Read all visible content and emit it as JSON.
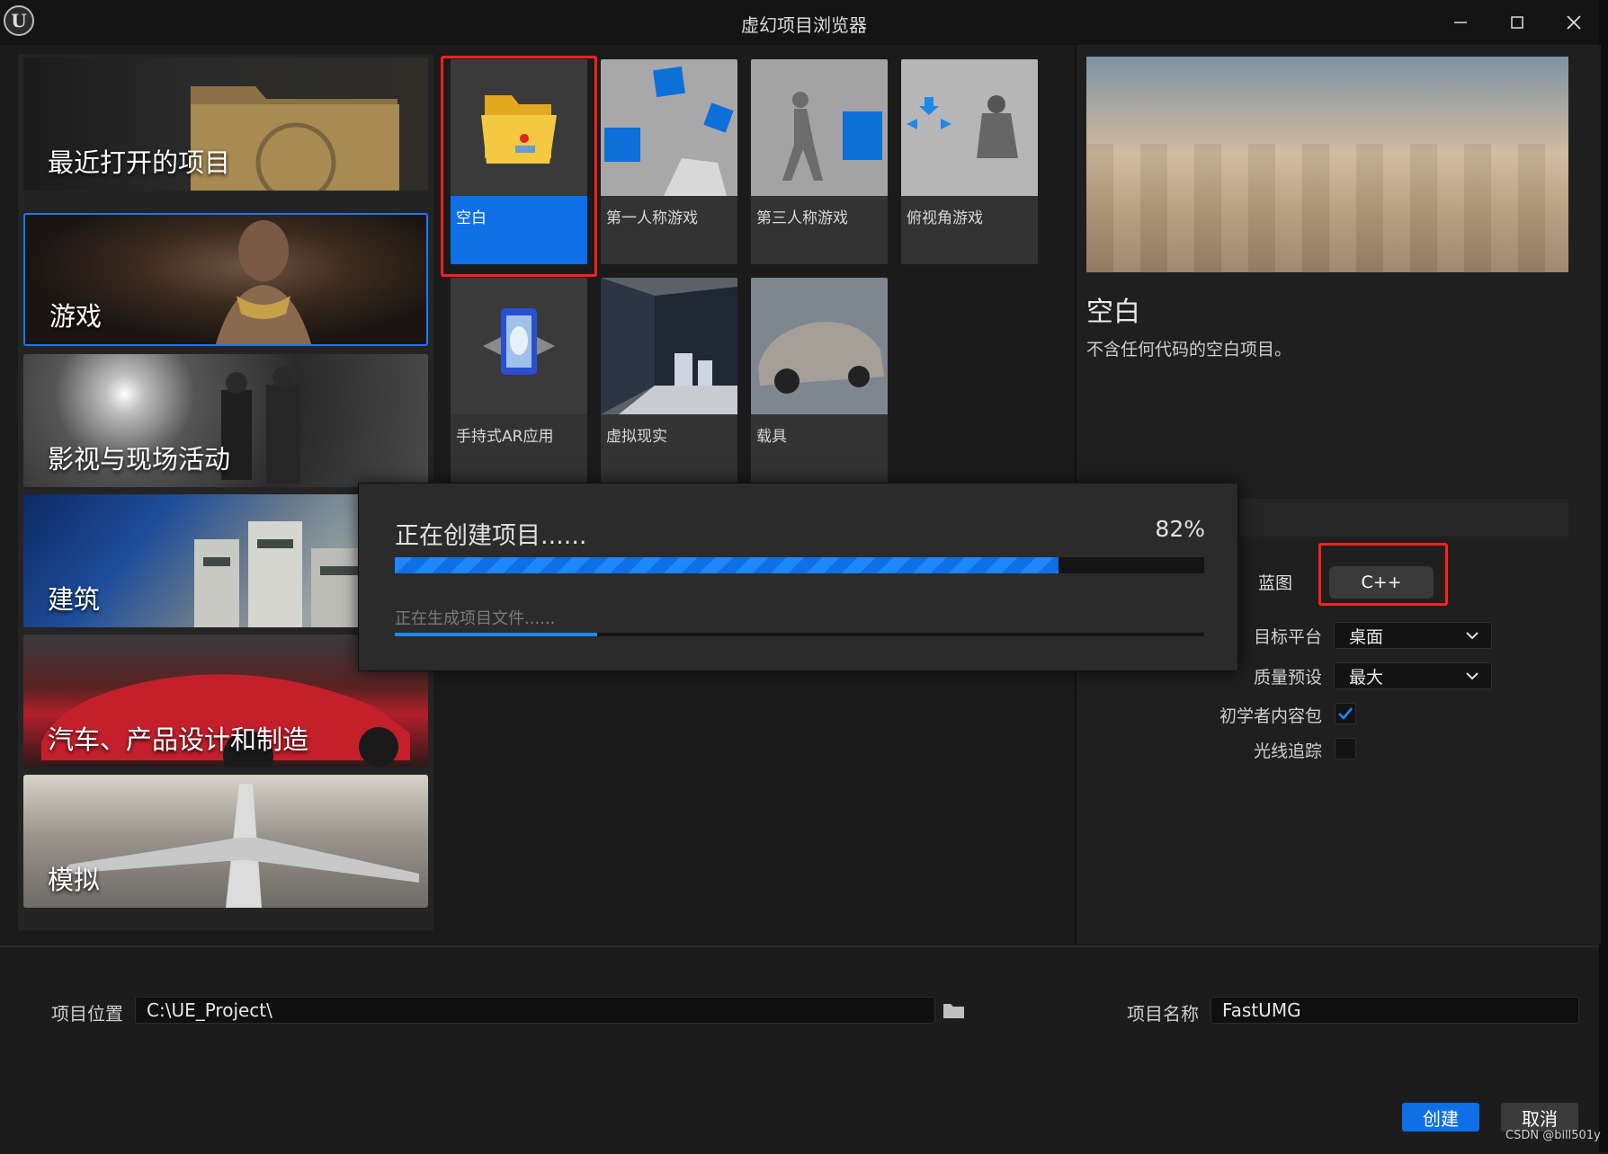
{
  "window": {
    "title": "虚幻项目浏览器",
    "logo": "unreal-logo",
    "controls": [
      "minimize-icon",
      "maximize-icon",
      "close-icon"
    ]
  },
  "categories": [
    {
      "label": "最近打开的项目"
    },
    {
      "label": "游戏",
      "selected": true
    },
    {
      "label": "影视与现场活动"
    },
    {
      "label": "建筑"
    },
    {
      "label": "汽车、产品设计和制造"
    },
    {
      "label": "模拟"
    }
  ],
  "templates": [
    {
      "label": "空白",
      "selected": true
    },
    {
      "label": "第一人称游戏"
    },
    {
      "label": "第三人称游戏"
    },
    {
      "label": "俯视角游戏"
    },
    {
      "label": "手持式AR应用"
    },
    {
      "label": "虚拟现实"
    },
    {
      "label": "载具"
    }
  ],
  "details": {
    "title": "空白",
    "description": "不含任何代码的空白项目。",
    "tabs": {
      "blueprint": "蓝图",
      "cpp": "C++",
      "selected": "C++"
    },
    "settings": {
      "target_platform_label": "目标平台",
      "target_platform_value": "桌面",
      "quality_label": "质量预设",
      "quality_value": "最大",
      "starter_content_label": "初学者内容包",
      "starter_content_checked": true,
      "raytracing_label": "光线追踪",
      "raytracing_checked": false
    }
  },
  "progress": {
    "title": "正在创建项目......",
    "percent_text": "82%",
    "percent": 82,
    "subtitle": "正在生成项目文件......",
    "sub_percent": 25
  },
  "bottom": {
    "location_label": "项目位置",
    "location_value": "C:\\UE_Project\\",
    "browse_icon": "folder-icon",
    "name_label": "项目名称",
    "name_value": "FastUMG",
    "create_label": "创建",
    "cancel_label": "取消"
  },
  "watermark": "CSDN @bill501y",
  "colors": {
    "accent": "#0e6fe6",
    "highlight": "#ff2020",
    "background": "#1b1b1b"
  }
}
